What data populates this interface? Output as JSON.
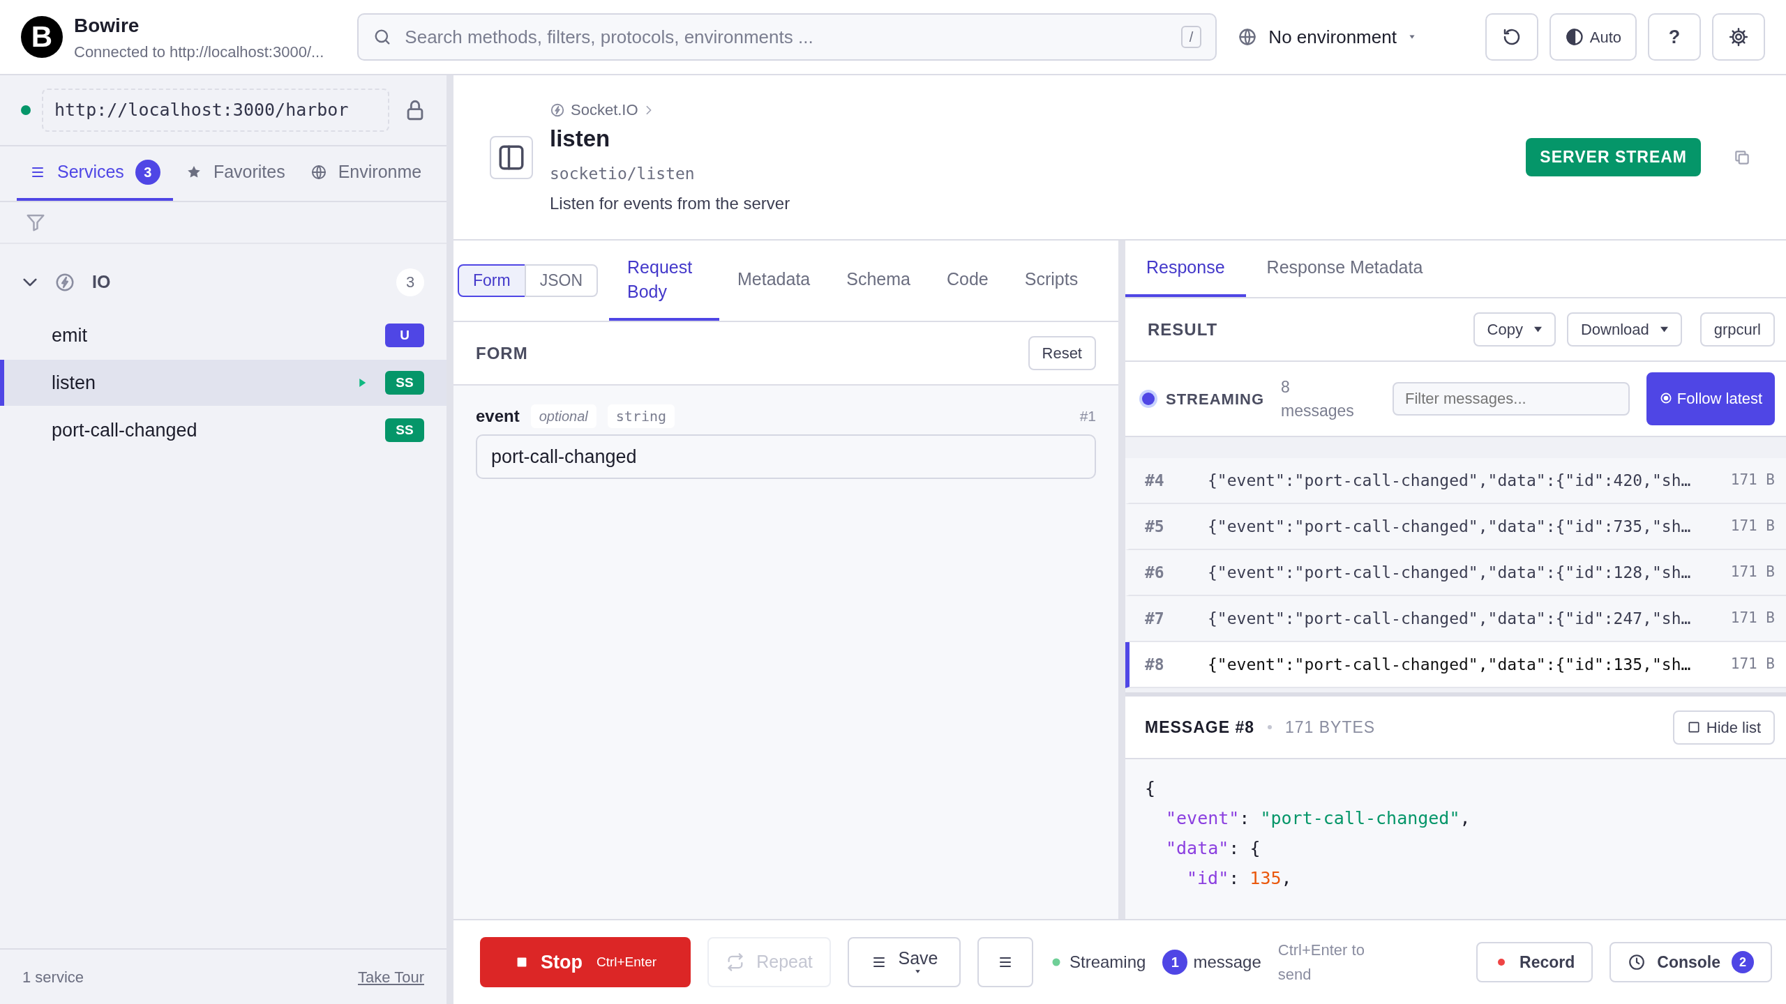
{
  "app": {
    "logo_letter": "B",
    "name": "Bowire",
    "subtitle": "Connected to http://localhost:3000/..."
  },
  "search": {
    "placeholder": "Search methods, filters, protocols, environments ...",
    "shortcut": "/"
  },
  "environment": {
    "label": "No environment"
  },
  "toolbar": {
    "theme_label": "Auto",
    "help_label": "?"
  },
  "sidebar": {
    "url": "http://localhost:3000/harbor",
    "connected": true,
    "tabs": [
      {
        "label": "Services",
        "count": "3",
        "selected": true,
        "kind": "services"
      },
      {
        "label": "Favorites",
        "selected": false,
        "kind": "favorites"
      },
      {
        "label": "Environme",
        "selected": false,
        "kind": "environments"
      }
    ],
    "groups": [
      {
        "name": "IO",
        "count": "3",
        "expanded": true,
        "children": [
          {
            "name": "emit",
            "badge": "U",
            "kind": "unary",
            "selected": false,
            "running": false
          },
          {
            "name": "listen",
            "badge": "SS",
            "kind": "server-stream",
            "selected": true,
            "running": true
          },
          {
            "name": "port-call-changed",
            "badge": "SS",
            "kind": "server-stream",
            "selected": false,
            "running": false
          }
        ]
      }
    ],
    "footer": {
      "count": "1 service",
      "tour": "Take Tour"
    }
  },
  "method": {
    "breadcrumb": "Socket.IO",
    "name": "listen",
    "path": "socketio/listen",
    "description": "Listen for events from the server",
    "type_badge": "SERVER STREAM",
    "kind": "server-stream"
  },
  "request": {
    "modes": [
      {
        "label": "Form",
        "selected": true
      },
      {
        "label": "JSON",
        "selected": false
      }
    ],
    "tabs": [
      {
        "label": "Request Body",
        "selected": true
      },
      {
        "label": "Metadata",
        "selected": false
      },
      {
        "label": "Schema",
        "selected": false
      },
      {
        "label": "Code",
        "selected": false
      },
      {
        "label": "Scripts",
        "selected": false
      }
    ],
    "form_title": "FORM",
    "reset": "Reset",
    "fields": [
      {
        "name": "event",
        "optional": "optional",
        "type": "string",
        "index": "#1",
        "value": "port-call-changed"
      }
    ]
  },
  "response": {
    "tabs": [
      {
        "label": "Response",
        "selected": true
      },
      {
        "label": "Response Metadata",
        "selected": false
      }
    ],
    "result_title": "RESULT",
    "actions": [
      {
        "label": "Copy",
        "dropdown": true
      },
      {
        "label": "Download",
        "dropdown": true
      },
      {
        "label": "grpcurl",
        "dropdown": false
      }
    ],
    "stream_status": "STREAMING",
    "message_count": "8",
    "message_count_label": "messages",
    "filter_placeholder": "Filter messages...",
    "follow": {
      "label": "Follow latest",
      "on": true
    },
    "messages": [
      {
        "index": "#4",
        "preview": "{\"event\":\"port-call-changed\",\"data\":{\"id\":420,\"sh…",
        "size": "171 B",
        "selected": false
      },
      {
        "index": "#5",
        "preview": "{\"event\":\"port-call-changed\",\"data\":{\"id\":735,\"sh…",
        "size": "171 B",
        "selected": false
      },
      {
        "index": "#6",
        "preview": "{\"event\":\"port-call-changed\",\"data\":{\"id\":128,\"sh…",
        "size": "171 B",
        "selected": false
      },
      {
        "index": "#7",
        "preview": "{\"event\":\"port-call-changed\",\"data\":{\"id\":247,\"sh…",
        "size": "171 B",
        "selected": false
      },
      {
        "index": "#8",
        "preview": "{\"event\":\"port-call-changed\",\"data\":{\"id\":135,\"sh…",
        "size": "171 B",
        "selected": true
      }
    ],
    "detail": {
      "title": "MESSAGE #8",
      "size": "171 BYTES",
      "hide_list": "Hide list",
      "code_lines": [
        {
          "tokens": [
            {
              "kind": "punct",
              "text": "{"
            }
          ],
          "children": [
            {
              "tokens": [
                {
                  "kind": "key",
                  "text": "\"event\""
                },
                {
                  "kind": "punct",
                  "text": ": "
                },
                {
                  "kind": "string",
                  "text": "\"port-call-changed\""
                },
                {
                  "kind": "punct",
                  "text": ","
                }
              ]
            },
            {
              "tokens": [
                {
                  "kind": "key",
                  "text": "\"data\""
                },
                {
                  "kind": "punct",
                  "text": ": {"
                }
              ],
              "children": [
                {
                  "tokens": [
                    {
                      "kind": "key",
                      "text": "\"id\""
                    },
                    {
                      "kind": "punct",
                      "text": ": "
                    },
                    {
                      "kind": "number",
                      "text": "135"
                    },
                    {
                      "kind": "punct",
                      "text": ","
                    }
                  ]
                }
              ]
            }
          ]
        }
      ]
    }
  },
  "bottom_bar": {
    "stop": "Stop",
    "stop_shortcut": "Ctrl+Enter",
    "repeat": {
      "label": "Repeat",
      "disabled": true
    },
    "save": "Save",
    "status": "Streaming",
    "message_count": "1",
    "message_label": "message",
    "hint": "Ctrl+Enter to send",
    "record": "Record",
    "console": "Console",
    "console_count": "2"
  }
}
